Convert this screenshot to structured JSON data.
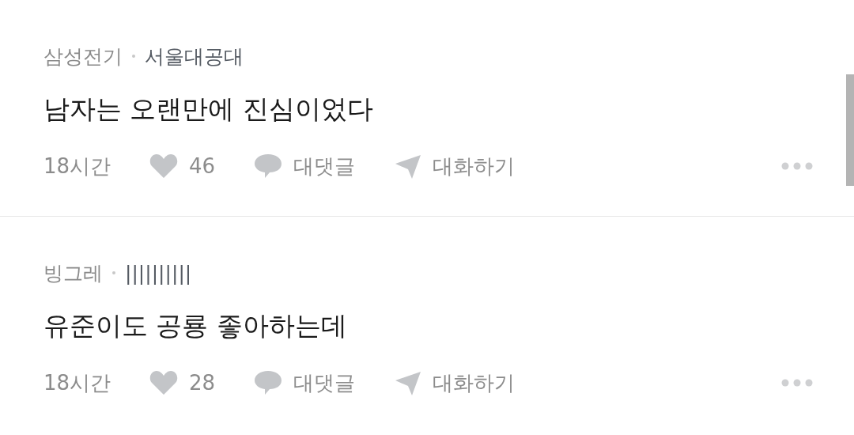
{
  "comments": [
    {
      "company": "삼성전기",
      "school": "서울대공대",
      "body": "남자는 오랜만에 진심이었다",
      "time": "18시간",
      "likes": "46",
      "reply_label": "대댓글",
      "chat_label": "대화하기"
    },
    {
      "company": "빙그레",
      "school": "||||||||||",
      "body": "유준이도 공룡 좋아하는데",
      "time": "18시간",
      "likes": "28",
      "reply_label": "대댓글",
      "chat_label": "대화하기"
    }
  ]
}
